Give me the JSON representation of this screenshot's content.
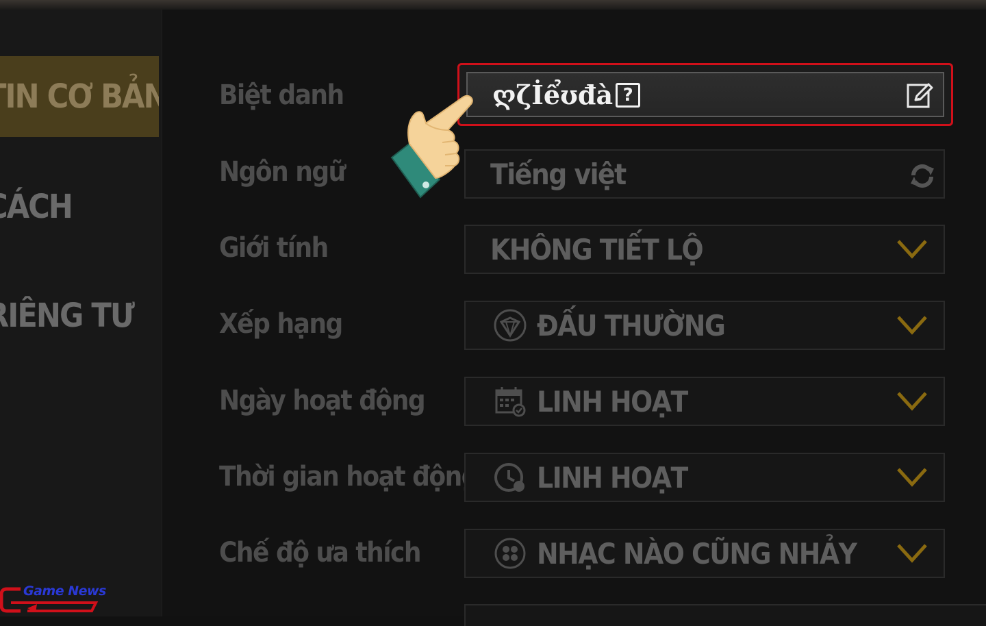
{
  "sidebar": {
    "items": [
      {
        "label": "TIN CƠ BẢN",
        "active": true
      },
      {
        "label": "CÁCH",
        "active": false
      },
      {
        "label": "RIÊNG TƯ",
        "active": false
      }
    ]
  },
  "form": {
    "rows": [
      {
        "label": "Biệt danh",
        "value": "ღζİểʊđà",
        "icon": "edit-icon"
      },
      {
        "label": "Ngôn ngữ",
        "value": "Tiếng việt",
        "icon": "refresh-icon"
      },
      {
        "label": "Giới tính",
        "value": "KHÔNG TIẾT LỘ",
        "icon": "chevron-down-icon"
      },
      {
        "label": "Xếp hạng",
        "value": "ĐẤU THƯỜNG",
        "icon": "rank-icon"
      },
      {
        "label": "Ngày hoạt động",
        "value": "LINH HOẠT",
        "icon": "calendar-icon"
      },
      {
        "label": "Thời gian hoạt động",
        "value": "LINH HOẠT",
        "icon": "clock-icon"
      },
      {
        "label": "Chế độ ưa thích",
        "value": "NHẠC NÀO CŨNG NHẢY",
        "icon": "mode-icon"
      }
    ],
    "unknown_glyph": "?"
  },
  "watermark": {
    "text": "Game News"
  },
  "colors": {
    "highlight": "#d0101a",
    "accent_chevron": "#8a6a10",
    "active_tab": "#4a3e1c"
  }
}
